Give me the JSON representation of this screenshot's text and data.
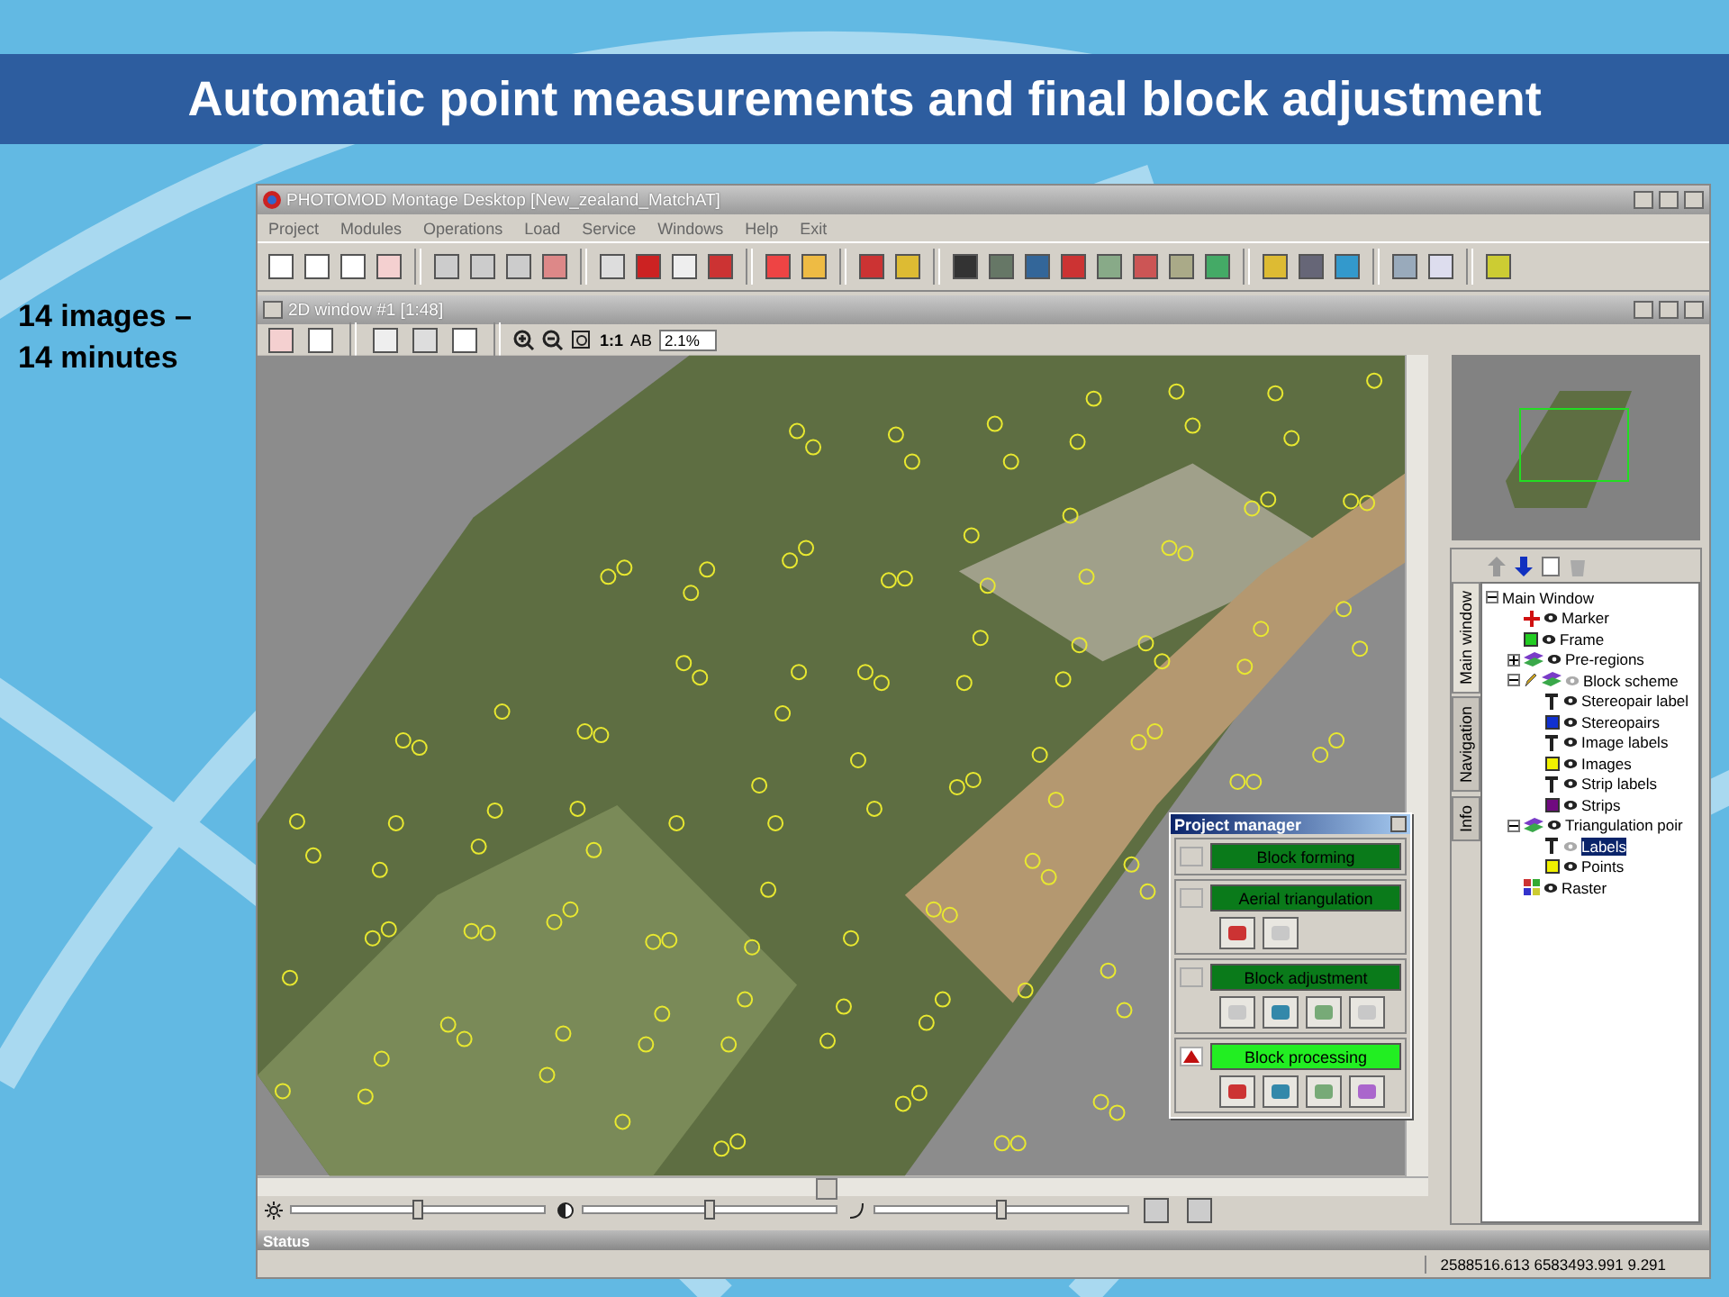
{
  "slide_title": "Automatic point measurements and final block adjustment",
  "side_note_lines": [
    "14 images –",
    "14 minutes"
  ],
  "app": {
    "title": "PHOTOMOD Montage Desktop [New_zealand_MatchAT]",
    "menu": [
      "Project",
      "Modules",
      "Operations",
      "Load",
      "Service",
      "Windows",
      "Help",
      "Exit"
    ],
    "inner_window": {
      "title": "2D window #1 [1:48]",
      "scale_label": "1:1",
      "label_toggle": "AB",
      "zoom_value": "2.1%"
    },
    "sliders": [
      {
        "kind": "brightness",
        "level": 0.5
      },
      {
        "kind": "contrast",
        "level": 0.5
      },
      {
        "kind": "gamma",
        "level": 0.5
      }
    ],
    "layers": {
      "tabs": [
        {
          "label": "Main window",
          "selected": true
        },
        {
          "label": "Navigation",
          "selected": false
        },
        {
          "label": "Info",
          "selected": false
        }
      ],
      "tree": [
        {
          "label": "Main Window",
          "expanded": true,
          "selected": false,
          "children": [
            {
              "label": "Marker",
              "kind": "marker",
              "visible": true,
              "selected": false
            },
            {
              "label": "Frame",
              "kind": "swatch",
              "color": "#22cc22",
              "visible": true,
              "selected": false
            },
            {
              "label": "Pre-regions",
              "kind": "layers",
              "visible": true,
              "expanded": false,
              "selected": false
            },
            {
              "label": "Block scheme",
              "kind": "layers",
              "visible": false,
              "edit": true,
              "expanded": true,
              "selected": false,
              "children": [
                {
                  "label": "Stereopair label",
                  "kind": "text",
                  "visible": true,
                  "selected": false
                },
                {
                  "label": "Stereopairs",
                  "kind": "swatch",
                  "color": "#1030d0",
                  "visible": true,
                  "selected": false
                },
                {
                  "label": "Image labels",
                  "kind": "text",
                  "visible": true,
                  "selected": false
                },
                {
                  "label": "Images",
                  "kind": "swatch",
                  "color": "#f0f000",
                  "visible": true,
                  "selected": false
                },
                {
                  "label": "Strip labels",
                  "kind": "text",
                  "visible": true,
                  "selected": false
                },
                {
                  "label": "Strips",
                  "kind": "swatch",
                  "color": "#700a80",
                  "visible": true,
                  "selected": false
                }
              ]
            },
            {
              "label": "Triangulation poir",
              "kind": "layers",
              "visible": true,
              "expanded": true,
              "selected": false,
              "children": [
                {
                  "label": "Labels",
                  "kind": "text",
                  "visible": false,
                  "selected": true
                },
                {
                  "label": "Points",
                  "kind": "swatch",
                  "color": "#f0f000",
                  "visible": true,
                  "selected": false
                }
              ]
            },
            {
              "label": "Raster",
              "kind": "raster",
              "visible": true,
              "selected": false
            }
          ]
        }
      ]
    },
    "project_manager": {
      "title": "Project manager",
      "stages": [
        {
          "label": "Block forming",
          "active": false,
          "alert": false
        },
        {
          "label": "Aerial triangulation",
          "active": false,
          "alert": false,
          "tools": [
            {
              "disabled": false
            },
            {
              "disabled": true
            }
          ]
        },
        {
          "label": "Block adjustment",
          "active": false,
          "alert": false,
          "tools": [
            {
              "disabled": true
            },
            {
              "disabled": false
            },
            {
              "disabled": false
            },
            {
              "disabled": true
            }
          ]
        },
        {
          "label": "Block processing",
          "active": true,
          "alert": true,
          "tools": [
            {
              "disabled": false
            },
            {
              "disabled": false
            },
            {
              "disabled": false
            },
            {
              "disabled": false
            }
          ]
        }
      ]
    },
    "status": {
      "title": "Status",
      "coordinates": "2588516.613 6583493.991 9.291"
    }
  }
}
